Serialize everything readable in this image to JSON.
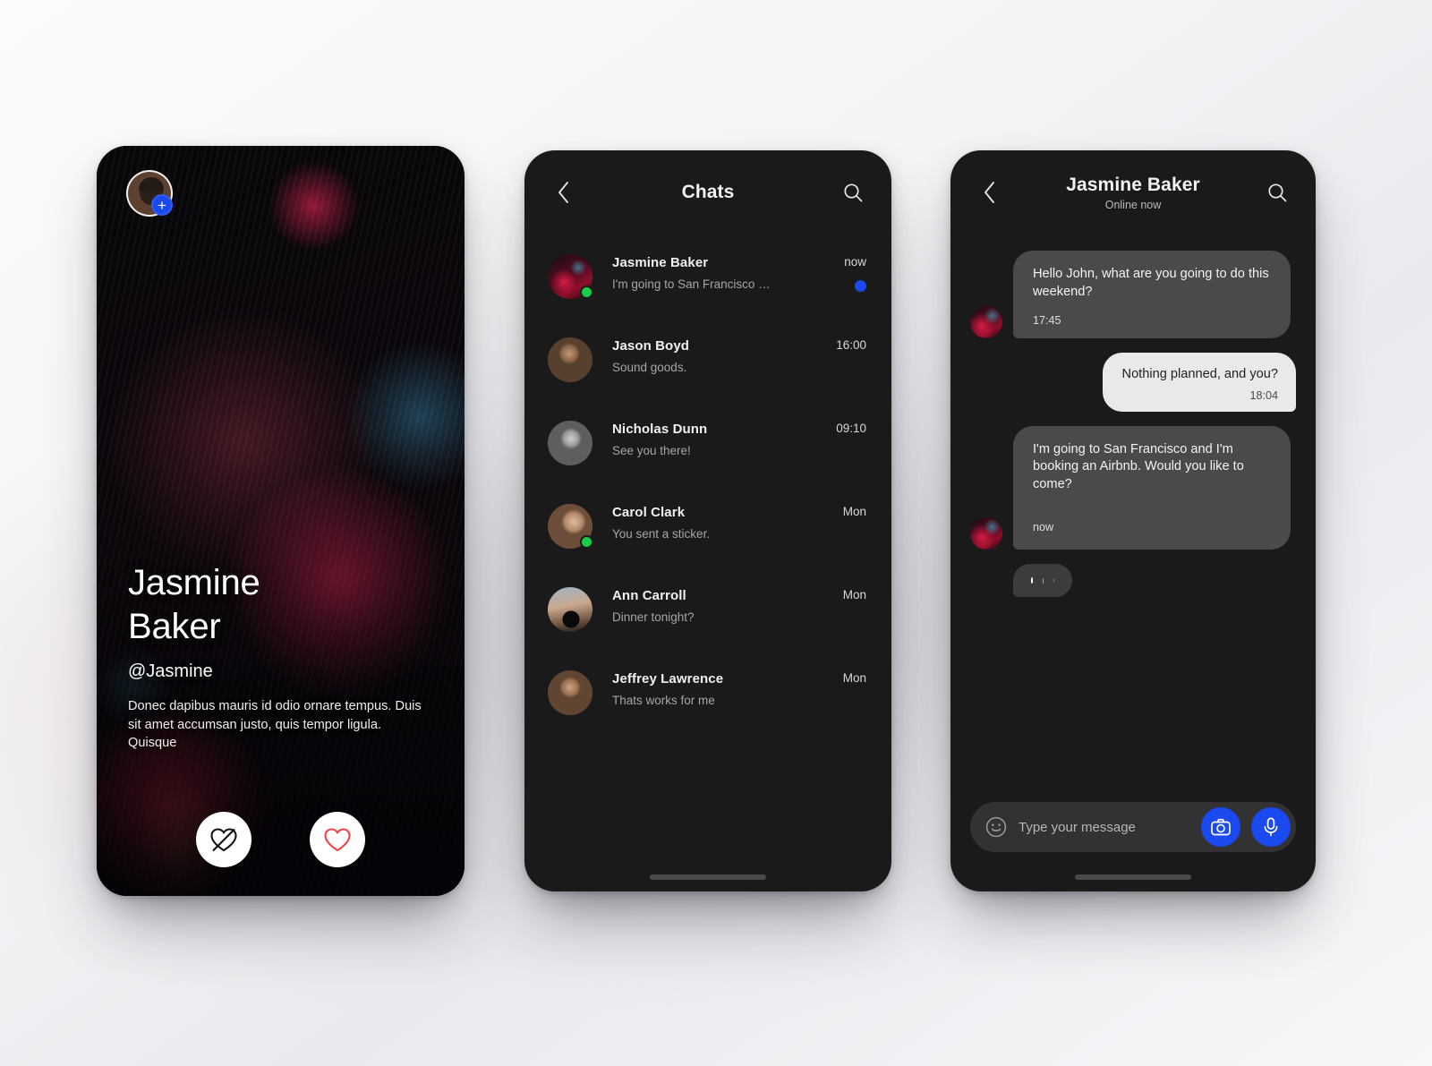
{
  "profile": {
    "name_line1": "Jasmine",
    "name_line2": "Baker",
    "handle": "@Jasmine",
    "bio": "Donec dapibus mauris id odio ornare tempus. Duis sit amet accumsan justo, quis tempor ligula. Quisque",
    "story_avatar_name": "story-avatar",
    "add_badge_label": "+",
    "pass_button_label": "pass",
    "like_button_label": "like",
    "like_color": "#ef4444",
    "badge_color": "#1a49f0"
  },
  "chatlist": {
    "title": "Chats",
    "back_icon": "chevron-left-icon",
    "search_icon": "search-icon",
    "unread_color": "#1a49f0",
    "online_color": "#19cc4a",
    "items": [
      {
        "name": "Jasmine Baker",
        "preview": "I'm going to San Francisco …",
        "time": "now",
        "online": true,
        "unread": true,
        "avatar": "av-jasmine"
      },
      {
        "name": "Jason Boyd",
        "preview": "Sound goods.",
        "time": "16:00",
        "online": false,
        "unread": false,
        "avatar": "av-jason"
      },
      {
        "name": "Nicholas Dunn",
        "preview": "See you there!",
        "time": "09:10",
        "online": false,
        "unread": false,
        "avatar": "av-nicholas"
      },
      {
        "name": "Carol Clark",
        "preview": "You sent a sticker.",
        "time": "Mon",
        "online": true,
        "unread": false,
        "avatar": "av-carol"
      },
      {
        "name": "Ann Carroll",
        "preview": "Dinner tonight?",
        "time": "Mon",
        "online": false,
        "unread": false,
        "avatar": "av-ann"
      },
      {
        "name": "Jeffrey Lawrence",
        "preview": "Thats works for me",
        "time": "Mon",
        "online": false,
        "unread": false,
        "avatar": "av-jeffrey"
      }
    ]
  },
  "conversation": {
    "title": "Jasmine Baker",
    "status": "Online now",
    "back_icon": "chevron-left-icon",
    "search_icon": "search-icon",
    "messages": [
      {
        "direction": "in",
        "text": "Hello John, what are you going to do this weekend?",
        "time": "17:45",
        "avatar": true,
        "tall": false
      },
      {
        "direction": "out",
        "text": "Nothing planned, and you?",
        "time": "18:04",
        "avatar": false,
        "tall": false
      },
      {
        "direction": "in",
        "text": "I'm going to San Francisco and I'm booking an Airbnb. Would you like to come?",
        "time": "now",
        "avatar": true,
        "tall": true
      }
    ],
    "typing_indicator": true,
    "composer": {
      "emoji_icon": "smiley-icon",
      "placeholder": "Type your message",
      "camera_icon": "camera-icon",
      "mic_icon": "microphone-icon",
      "accent_color": "#1a49f0"
    }
  }
}
